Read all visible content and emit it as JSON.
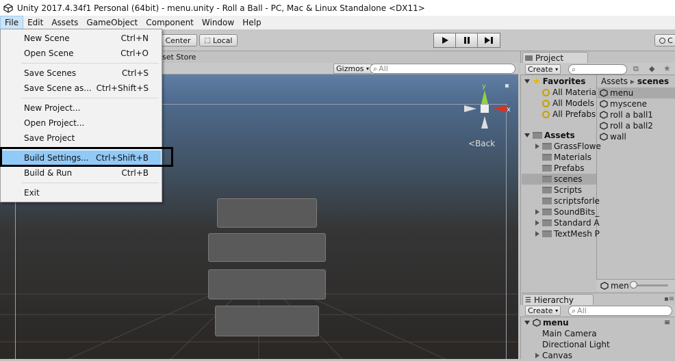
{
  "window_title": "Unity 2017.4.34f1 Personal (64bit) - menu.unity - Roll a Ball - PC, Mac & Linux Standalone <DX11>",
  "menubar": [
    "File",
    "Edit",
    "Assets",
    "GameObject",
    "Component",
    "Window",
    "Help"
  ],
  "toolbar": {
    "center_label": "Center",
    "local_label": "Local",
    "right_label": "C"
  },
  "scene": {
    "asset_store_tab": "set Store",
    "gizmos_label": "Gizmos",
    "search_placeholder": "All",
    "back_label": "Back",
    "axis_y": "y",
    "axis_x": "x"
  },
  "file_menu": [
    {
      "label": "New Scene",
      "shortcut": "Ctrl+N"
    },
    {
      "label": "Open Scene",
      "shortcut": "Ctrl+O"
    },
    {
      "label": "Save Scenes",
      "shortcut": "Ctrl+S"
    },
    {
      "label": "Save Scene as...",
      "shortcut": "Ctrl+Shift+S"
    },
    {
      "label": "New Project...",
      "shortcut": ""
    },
    {
      "label": "Open Project...",
      "shortcut": ""
    },
    {
      "label": "Save Project",
      "shortcut": ""
    },
    {
      "label": "Build Settings...",
      "shortcut": "Ctrl+Shift+B"
    },
    {
      "label": "Build & Run",
      "shortcut": "Ctrl+B"
    },
    {
      "label": "Exit",
      "shortcut": ""
    }
  ],
  "project": {
    "tab_label": "Project",
    "create_label": "Create",
    "favorites_label": "Favorites",
    "favorites": [
      "All Materia",
      "All Models",
      "All Prefabs"
    ],
    "assets_label": "Assets",
    "folders": [
      "GrassFlowe",
      "Materials",
      "Prefabs",
      "scenes",
      "Scripts",
      "scriptsforle",
      "SoundBits_",
      "Standard A",
      "TextMesh P"
    ],
    "breadcrumb_root": "Assets",
    "breadcrumb_current": "scenes",
    "scene_files": [
      "menu",
      "myscene",
      "roll a ball1",
      "roll a ball2",
      "wall"
    ],
    "footer_label": "men"
  },
  "hierarchy": {
    "tab_label": "Hierarchy",
    "create_label": "Create",
    "search_placeholder": "All",
    "scene_label": "menu",
    "items": [
      "Main Camera",
      "Directional Light",
      "Canvas"
    ]
  }
}
